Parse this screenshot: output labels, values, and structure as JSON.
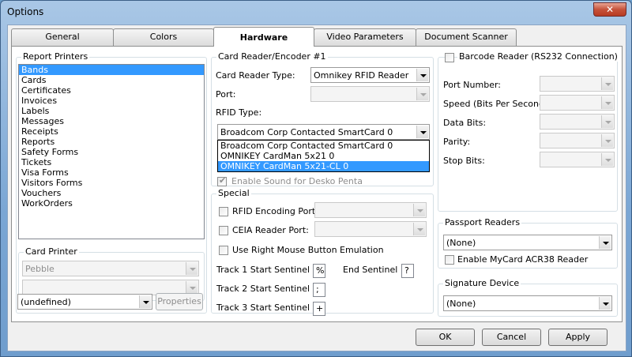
{
  "window": {
    "title": "Options",
    "close_glyph": "✕"
  },
  "tabs": [
    "General",
    "Colors",
    "Hardware",
    "Video Parameters",
    "Document Scanner"
  ],
  "report_printers": {
    "label": "Report Printers",
    "items": [
      "Bands",
      "Cards",
      "Certificates",
      "Invoices",
      "Labels",
      "Messages",
      "Receipts",
      "Reports",
      "Safety Forms",
      "Tickets",
      "Visa Forms",
      "Visitors Forms",
      "Vouchers",
      "WorkOrders"
    ],
    "selected": "Bands"
  },
  "card_printer": {
    "label": "Card Printer",
    "value": "Pebble",
    "value2": ""
  },
  "bottom_left": {
    "combo": "(undefined)",
    "properties": "Properties"
  },
  "card_reader": {
    "group": "Card Reader/Encoder #1",
    "type_label": "Card Reader Type:",
    "type_value": "Omnikey RFID Reader",
    "port_label": "Port:",
    "port_value": "",
    "rfid_label": "RFID Type:",
    "rfid_value": "Broadcom Corp Contacted SmartCard 0",
    "rfid_options": [
      "Broadcom Corp Contacted SmartCard 0",
      "OMNIKEY CardMan 5x21 0",
      "OMNIKEY CardMan 5x21-CL 0"
    ],
    "rfid_selected": "OMNIKEY CardMan 5x21-CL 0",
    "sound_label": "Enable Sound for Desko Penta"
  },
  "special": {
    "group": "Special",
    "rfid_port": "RFID Encoding Port:",
    "ceia_port": "CEIA Reader Port:",
    "right_mouse": "Use Right Mouse Button Emulation",
    "track1": "Track 1 Start Sentinel :",
    "track1_val": "%",
    "end_sentinel": "End Sentinel :",
    "end_val": "?",
    "track2": "Track 2 Start Sentinel :",
    "track2_val": ";",
    "track3": "Track 3 Start Sentinel :",
    "track3_val": "+"
  },
  "barcode": {
    "label": "Barcode Reader (RS232 Connection)",
    "port": "Port Number:",
    "speed": "Speed (Bits Per Second):",
    "data_bits": "Data Bits:",
    "parity": "Parity:",
    "stop_bits": "Stop Bits:"
  },
  "passport": {
    "group": "Passport Readers",
    "value": "(None)",
    "mycard": "Enable MyCard ACR38 Reader"
  },
  "signature": {
    "group": "Signature Device",
    "value": "(None)"
  },
  "buttons": {
    "ok": "OK",
    "cancel": "Cancel",
    "apply": "Apply"
  }
}
